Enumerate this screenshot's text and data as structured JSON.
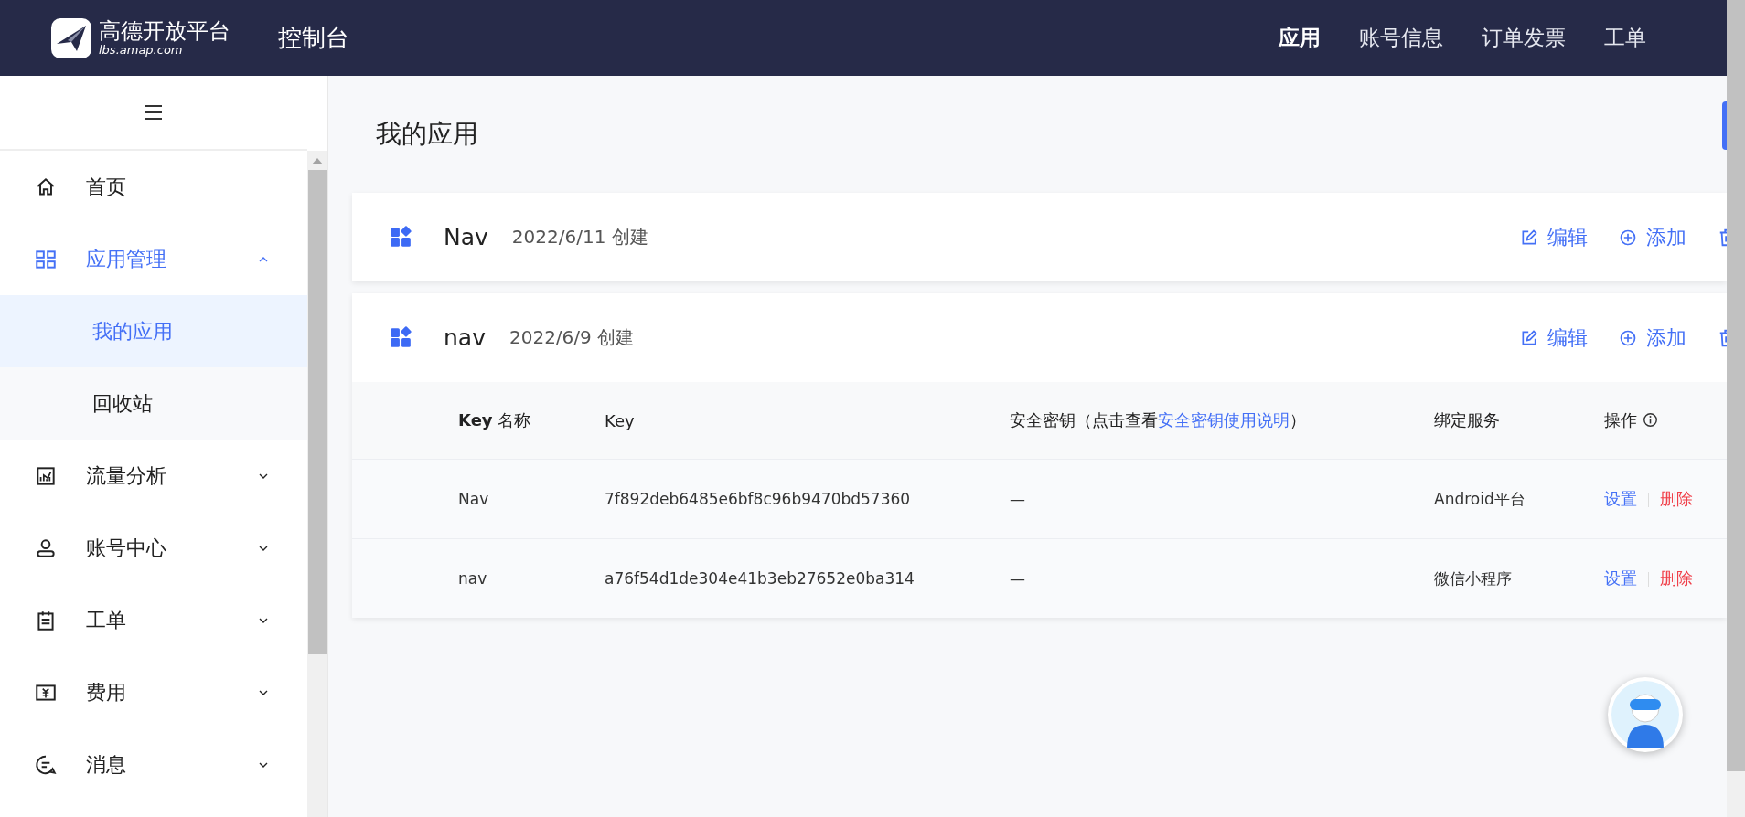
{
  "header": {
    "logo_title": "高德开放平台",
    "logo_subtitle": "lbs.amap.com",
    "console": "控制台",
    "nav": [
      {
        "label": "应用",
        "selected": true
      },
      {
        "label": "账号信息",
        "selected": false
      },
      {
        "label": "订单发票",
        "selected": false
      },
      {
        "label": "工单",
        "selected": false
      }
    ]
  },
  "sidebar": {
    "items": [
      {
        "label": "首页",
        "kind": "link",
        "selected": false
      },
      {
        "label": "应用管理",
        "kind": "group",
        "expanded": true,
        "children": [
          {
            "label": "我的应用",
            "selected": true
          },
          {
            "label": "回收站",
            "selected": false
          }
        ]
      },
      {
        "label": "流量分析",
        "kind": "group",
        "expanded": false
      },
      {
        "label": "账号中心",
        "kind": "group",
        "expanded": false
      },
      {
        "label": "工单",
        "kind": "group",
        "expanded": false
      },
      {
        "label": "费用",
        "kind": "group",
        "expanded": false
      },
      {
        "label": "消息",
        "kind": "group",
        "expanded": false
      }
    ]
  },
  "page_title": "我的应用",
  "apps": [
    {
      "name": "Nav",
      "created": "2022/6/11 创建",
      "actions": [
        "编辑",
        "添加"
      ]
    },
    {
      "name": "nav",
      "created": "2022/6/9 创建",
      "actions": [
        "编辑",
        "添加"
      ],
      "table": {
        "columns": [
          {
            "label": "**Key** 名称"
          },
          {
            "label": "Key"
          },
          {
            "label": "安全密钥（点击查看",
            "link": "安全密钥使用说明",
            "suffix": "）"
          },
          {
            "label": "绑定服务"
          },
          {
            "label": "操作",
            "info": true
          }
        ],
        "rows": [
          {
            "cells": [
              "Nav",
              "7f892deb6485e6bf8c96b9470bd57360",
              "—",
              "Android平台"
            ],
            "ops": [
              "设置",
              "删除"
            ]
          },
          {
            "cells": [
              "nav",
              "a76f54d1de304e41b3eb27652e0ba314",
              "—",
              "微信小程序"
            ],
            "ops": [
              "设置",
              "删除"
            ]
          }
        ]
      }
    }
  ]
}
